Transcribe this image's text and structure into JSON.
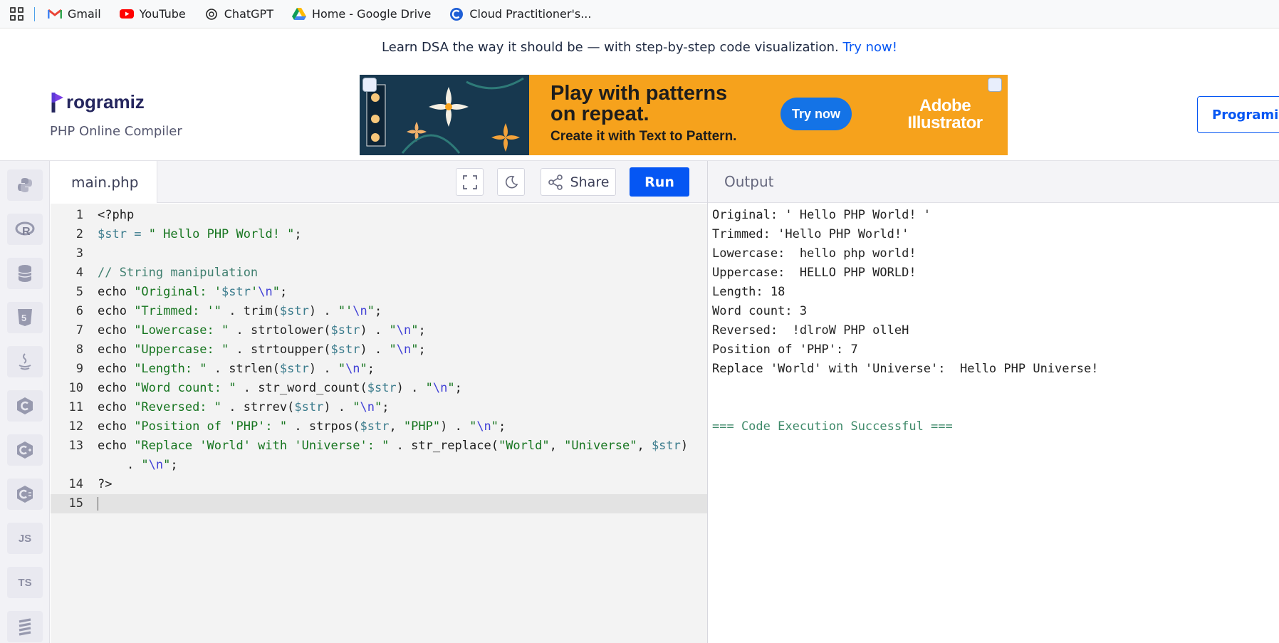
{
  "bookmarks": [
    {
      "label": "Gmail",
      "icon": "gmail-icon"
    },
    {
      "label": "YouTube",
      "icon": "youtube-icon"
    },
    {
      "label": "ChatGPT",
      "icon": "chatgpt-icon"
    },
    {
      "label": "Home - Google Drive",
      "icon": "google-drive-icon"
    },
    {
      "label": "Cloud Practitioner's...",
      "icon": "cloud-practitioner-icon"
    }
  ],
  "promo": {
    "text": "Learn DSA the way it should be — with step-by-step code visualization.",
    "link": "Try now!"
  },
  "brand": {
    "logo_text": "rogramiz",
    "subtitle": "PHP Online Compiler",
    "pro_button": "Programiz PRO"
  },
  "ad": {
    "headline_1": "Play with patterns",
    "headline_2": "on repeat.",
    "subline": "Create it with Text to Pattern.",
    "cta": "Try now",
    "brand_1": "Adobe",
    "brand_2": "Illustrator",
    "accent": "#f6a21c"
  },
  "rail": [
    "python-icon",
    "r-icon",
    "sql-database-icon",
    "html5-icon",
    "java-icon",
    "c-icon",
    "cpp-icon",
    "csharp-icon",
    "JS",
    "TS",
    "go-icon"
  ],
  "editor": {
    "filename": "main.php",
    "share_label": "Share",
    "run_label": "Run",
    "line_numbers": [
      "1",
      "2",
      "3",
      "4",
      "5",
      "6",
      "7",
      "8",
      "9",
      "10",
      "11",
      "12",
      "13",
      "",
      "14",
      "15"
    ]
  },
  "output": {
    "title": "Output",
    "lines": [
      "Original: ' Hello PHP World! '",
      "Trimmed: 'Hello PHP World!'",
      "Lowercase:  hello php world!",
      "Uppercase:  HELLO PHP WORLD!",
      "Length: 18",
      "Word count: 3",
      "Reversed:  !dlroW PHP olleH",
      "Position of 'PHP': 7",
      "Replace 'World' with 'Universe':  Hello PHP Universe!",
      "",
      "",
      "=== Code Execution Successful ==="
    ]
  },
  "colors": {
    "primary": "#0556f3",
    "brand": "#25265e",
    "success": "#3f8a6a"
  }
}
